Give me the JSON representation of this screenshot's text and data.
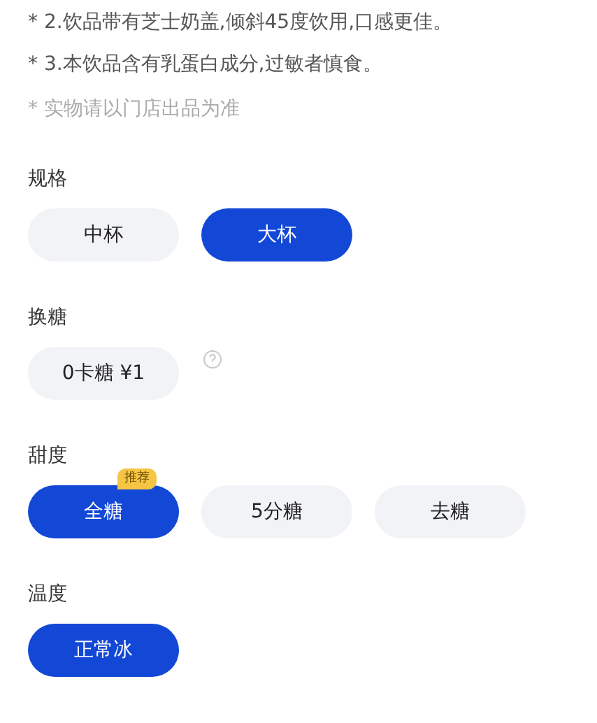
{
  "notes": [
    {
      "text": "* 2.饮品带有芝士奶盖,倾斜45度饮用,口感更佳。",
      "muted": false
    },
    {
      "text": "* 3.本饮品含有乳蛋白成分,过敏者慎食。",
      "muted": false
    },
    {
      "text": "* 实物请以门店出品为准",
      "muted": true
    }
  ],
  "sections": [
    {
      "title": "规格",
      "help": false,
      "options": [
        {
          "label": "中杯",
          "selected": false
        },
        {
          "label": "大杯",
          "selected": true
        }
      ]
    },
    {
      "title": "换糖",
      "help": true,
      "options": [
        {
          "label": "0卡糖 ¥1",
          "selected": false
        }
      ]
    },
    {
      "title": "甜度",
      "help": false,
      "options": [
        {
          "label": "全糖",
          "selected": true,
          "badge": "推荐"
        },
        {
          "label": "5分糖",
          "selected": false
        },
        {
          "label": "去糖",
          "selected": false
        }
      ]
    },
    {
      "title": "温度",
      "help": false,
      "options": [
        {
          "label": "正常冰",
          "selected": true
        }
      ]
    }
  ]
}
